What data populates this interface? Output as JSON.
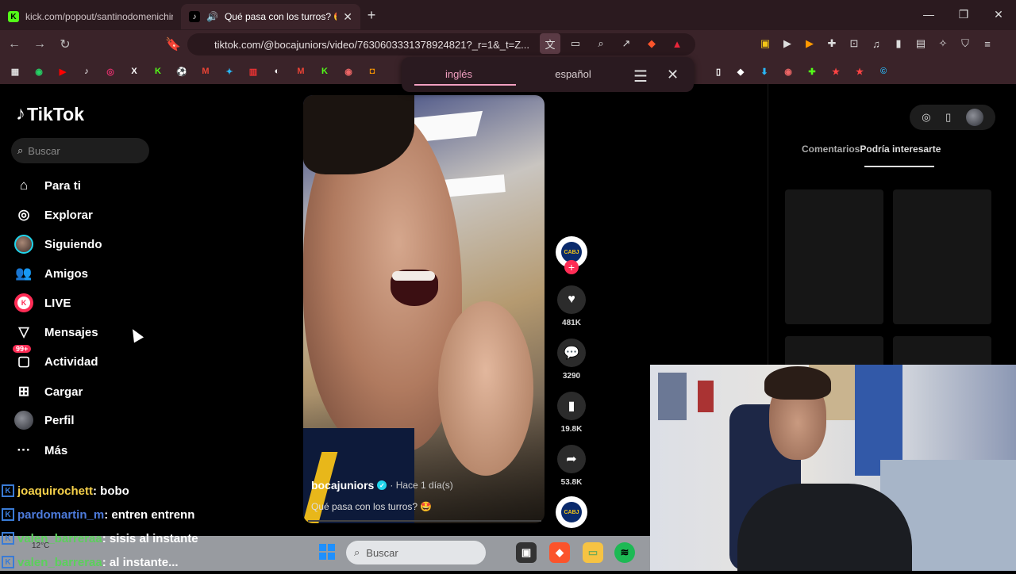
{
  "browser": {
    "tabs": [
      {
        "label": "kick.com/popout/santinodomenichini",
        "favicon": "K",
        "active": false
      },
      {
        "label": "Qué pasa con los turros? 🤩",
        "favicon": "♪",
        "active": true
      }
    ],
    "url": "tiktok.com/@bocajuniors/video/7630603331378924821?_r=1&_t=Z...",
    "translate": {
      "tab1": "inglés",
      "tab2": "español"
    }
  },
  "tiktok": {
    "logo": "TikTok",
    "search_placeholder": "Buscar",
    "nav": [
      {
        "label": "Para ti",
        "icon": "home-icon"
      },
      {
        "label": "Explorar",
        "icon": "compass-icon"
      },
      {
        "label": "Siguiendo",
        "icon": "following-avatar-icon"
      },
      {
        "label": "Amigos",
        "icon": "friends-icon"
      },
      {
        "label": "LIVE",
        "icon": "live-icon"
      },
      {
        "label": "Mensajes",
        "icon": "send-icon"
      },
      {
        "label": "Actividad",
        "icon": "inbox-icon",
        "badge": "99+"
      },
      {
        "label": "Cargar",
        "icon": "upload-icon"
      },
      {
        "label": "Perfil",
        "icon": "profile-avatar-icon"
      },
      {
        "label": "Más",
        "icon": "more-icon"
      }
    ],
    "video": {
      "username": "bocajuniors",
      "time": "· Hace 1 día(s)",
      "description": "Qué pasa con los turros? 🤩",
      "club_badge": "CABJ"
    },
    "actions": {
      "likes": "481K",
      "comments": "3290",
      "saves": "19.8K",
      "shares": "53.8K"
    },
    "right_panel": {
      "tab_comments": "Comentarios",
      "tab_interest": "Podría interesarte"
    }
  },
  "chat": [
    {
      "user": "joaquirochett",
      "msg": ": bobo",
      "color": "#f5d04a"
    },
    {
      "user": "pardomartin_m",
      "msg": ": entren entrenn",
      "color": "#4d7bdc"
    },
    {
      "user": "valen_barreraa",
      "msg": ": sisis al instante",
      "color": "#5bd05b"
    },
    {
      "user": "valen_barreraa",
      "msg": ": al instante...",
      "color": "#5bd05b"
    }
  ],
  "taskbar": {
    "weather": "12°C",
    "search_placeholder": "Buscar"
  },
  "colors": {
    "tiktok_red": "#fe2c55",
    "browser_bg": "#3a2329"
  }
}
